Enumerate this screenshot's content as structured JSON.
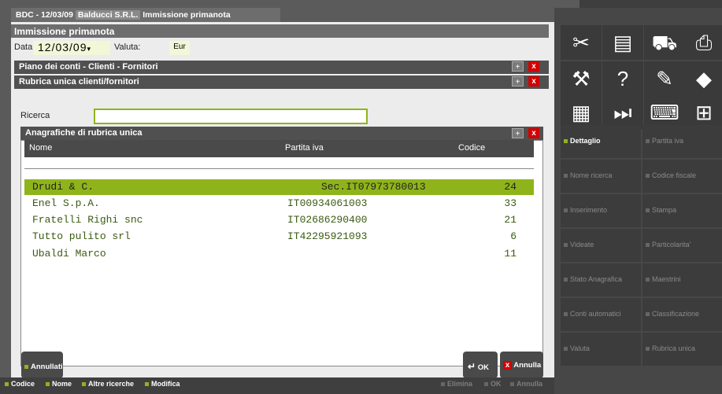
{
  "title_tab": {
    "date": "BDC - 12/03/09",
    "company": "Balducci S.R.L.",
    "window": "Immissione primanota"
  },
  "window_title": "Immissione primanota",
  "form": {
    "data_label": "Data",
    "data_value": "12/03/09",
    "valuta_label": "Valuta:",
    "valuta_value": "Eur"
  },
  "panels": {
    "piano": "Piano dei conti - Clienti - Fornitori",
    "rubrica": "Rubrica unica clienti/fornitori",
    "anagrafiche": "Anagrafiche di rubrica unica"
  },
  "controls": {
    "plus": "+",
    "close": "x"
  },
  "search": {
    "label": "Ricerca",
    "value": ""
  },
  "table": {
    "headers": {
      "nome": "Nome",
      "piva": "Partita iva",
      "codice": "Codice"
    },
    "rows": [
      {
        "nome": "Drudi & C.",
        "piva": "Sec.IT07973780013",
        "codice": "24"
      },
      {
        "nome": "Enel S.p.A.",
        "piva": "IT00934061003",
        "codice": "33"
      },
      {
        "nome": "Fratelli Righi snc",
        "piva": "IT02686290400",
        "codice": "21"
      },
      {
        "nome": "Tutto pulito srl",
        "piva": "IT42295921093",
        "codice": "6"
      },
      {
        "nome": "Ubaldi Marco",
        "piva": "",
        "codice": "11"
      }
    ]
  },
  "buttons": {
    "annullati": "Annullati",
    "ok": "OK",
    "annulla": "Annulla"
  },
  "bottom_bar": {
    "codice": "Codice",
    "nome": "Nome",
    "altre": "Altre ricerche",
    "modifica": "Modifica",
    "elimina": "Elimina",
    "ok": "OK",
    "annulla": "Annulla"
  },
  "icons": [
    "scissors-icon",
    "paste-icon",
    "truck-icon",
    "printer-icon",
    "wrench-icon",
    "help-icon",
    "notebook-icon",
    "cube-icon",
    "calculator-icon",
    "fast-forward-icon",
    "keyboard-icon",
    "grid-icon"
  ],
  "icon_glyphs": [
    "✂",
    "▤",
    "⛟",
    "⎙",
    "⚒",
    "?",
    "✎",
    "◆",
    "▦",
    "⏭",
    "⌨",
    "⊞"
  ],
  "right_buttons": [
    {
      "label": "Dettaglio",
      "active": true
    },
    {
      "label": "Partita iva",
      "active": false
    },
    {
      "label": "Nome ricerca",
      "active": false
    },
    {
      "label": "Codice fiscale",
      "active": false
    },
    {
      "label": "Inserimento",
      "active": false
    },
    {
      "label": "Stampa",
      "active": false
    },
    {
      "label": "Videate",
      "active": false
    },
    {
      "label": "Particolarita'",
      "active": false
    },
    {
      "label": "Stato Anagrafica",
      "active": false
    },
    {
      "label": "Maestrini",
      "active": false
    },
    {
      "label": "Conti automatici",
      "active": false
    },
    {
      "label": "Classificazione",
      "active": false
    },
    {
      "label": "Valuta",
      "active": false
    },
    {
      "label": "Rubrica unica",
      "active": false
    }
  ],
  "colors": {
    "accent": "#8fb41b",
    "close": "#d40000"
  }
}
